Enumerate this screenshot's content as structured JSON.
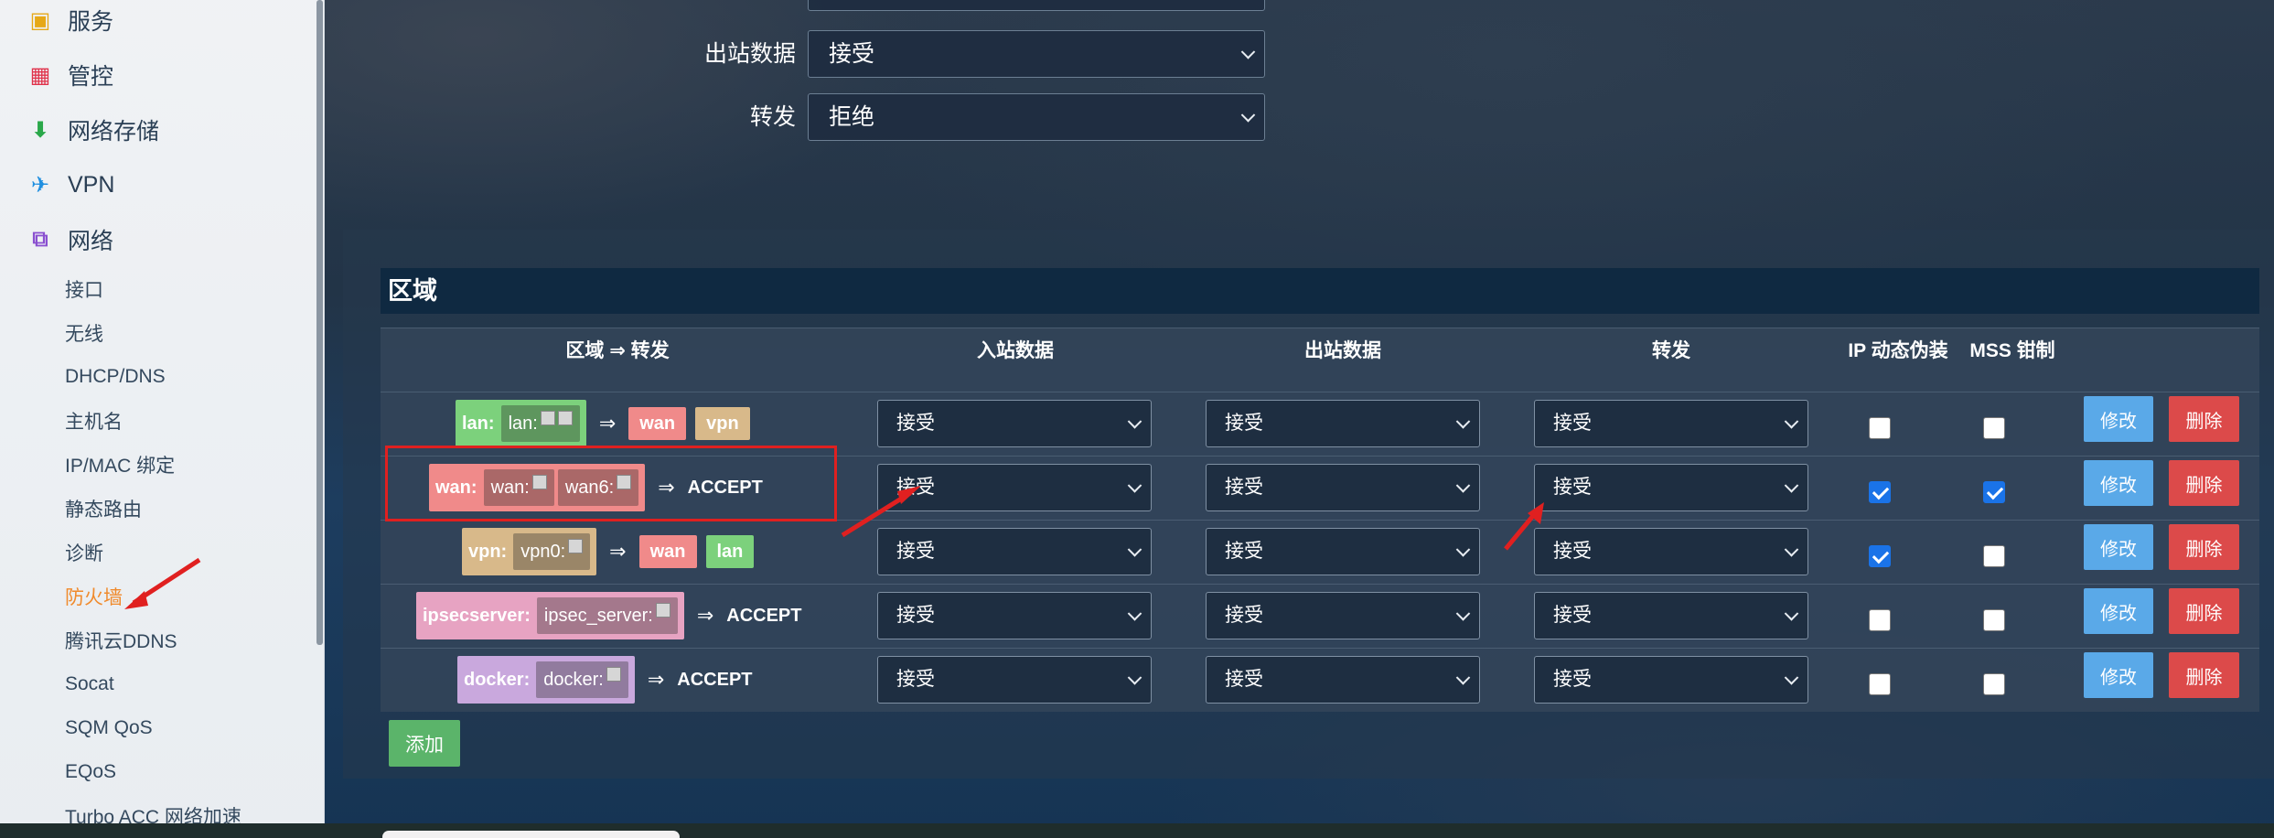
{
  "sidebar": {
    "menu": [
      {
        "label": "服务",
        "icon": "services-icon",
        "color": "#e6a817"
      },
      {
        "label": "管控",
        "icon": "control-icon",
        "color": "#e0334b"
      },
      {
        "label": "网络存储",
        "icon": "storage-icon",
        "color": "#2aa84a"
      },
      {
        "label": "VPN",
        "icon": "vpn-icon",
        "color": "#1f8fe0"
      },
      {
        "label": "网络",
        "icon": "network-icon",
        "color": "#8a4fd0"
      }
    ],
    "submenu": [
      {
        "label": "接口"
      },
      {
        "label": "无线"
      },
      {
        "label": "DHCP/DNS"
      },
      {
        "label": "主机名"
      },
      {
        "label": "IP/MAC 绑定"
      },
      {
        "label": "静态路由"
      },
      {
        "label": "诊断"
      },
      {
        "label": "防火墙",
        "active": true
      },
      {
        "label": "腾讯云DDNS"
      },
      {
        "label": "Socat"
      },
      {
        "label": "SQM QoS"
      },
      {
        "label": "EQoS"
      },
      {
        "label": "Turbo ACC 网络加速"
      }
    ]
  },
  "top_form": {
    "rows": [
      {
        "label": "出站数据",
        "value": "接受"
      },
      {
        "label": "转发",
        "value": "拒绝"
      }
    ]
  },
  "zones": {
    "title": "区域",
    "headers": {
      "zone": "区域 ⇒ 转发",
      "input": "入站数据",
      "output": "出站数据",
      "forward": "转发",
      "masq": "IP 动态伪装",
      "mss": "MSS 钳制"
    },
    "rows": [
      {
        "zone": "lan:",
        "ifaces": [
          "lan:"
        ],
        "dests": [
          "wan",
          "vpn"
        ],
        "accept": "",
        "input": "接受",
        "output": "接受",
        "forward": "接受",
        "masq": false,
        "mss": false,
        "color": "#7cd17c"
      },
      {
        "zone": "wan:",
        "ifaces": [
          "wan:",
          "wan6:"
        ],
        "dests": [],
        "accept": "ACCEPT",
        "input": "接受",
        "output": "接受",
        "forward": "接受",
        "masq": true,
        "mss": true,
        "color": "#f08a8a"
      },
      {
        "zone": "vpn:",
        "ifaces": [
          "vpn0:"
        ],
        "dests": [
          "wan",
          "lan"
        ],
        "accept": "",
        "input": "接受",
        "output": "接受",
        "forward": "接受",
        "masq": true,
        "mss": false,
        "color": "#d8b98a"
      },
      {
        "zone": "ipsecserver:",
        "ifaces": [
          "ipsec_server:"
        ],
        "dests": [],
        "accept": "ACCEPT",
        "input": "接受",
        "output": "接受",
        "forward": "接受",
        "masq": false,
        "mss": false,
        "color": "#e7a3c2"
      },
      {
        "zone": "docker:",
        "ifaces": [
          "docker:"
        ],
        "dests": [],
        "accept": "ACCEPT",
        "input": "接受",
        "output": "接受",
        "forward": "接受",
        "masq": false,
        "mss": false,
        "color": "#c9a8dd"
      }
    ],
    "dest_colors": {
      "wan": "#f08a8a",
      "vpn": "#d8b98a",
      "lan": "#7cd17c"
    },
    "edit_label": "修改",
    "delete_label": "删除",
    "add_label": "添加"
  }
}
